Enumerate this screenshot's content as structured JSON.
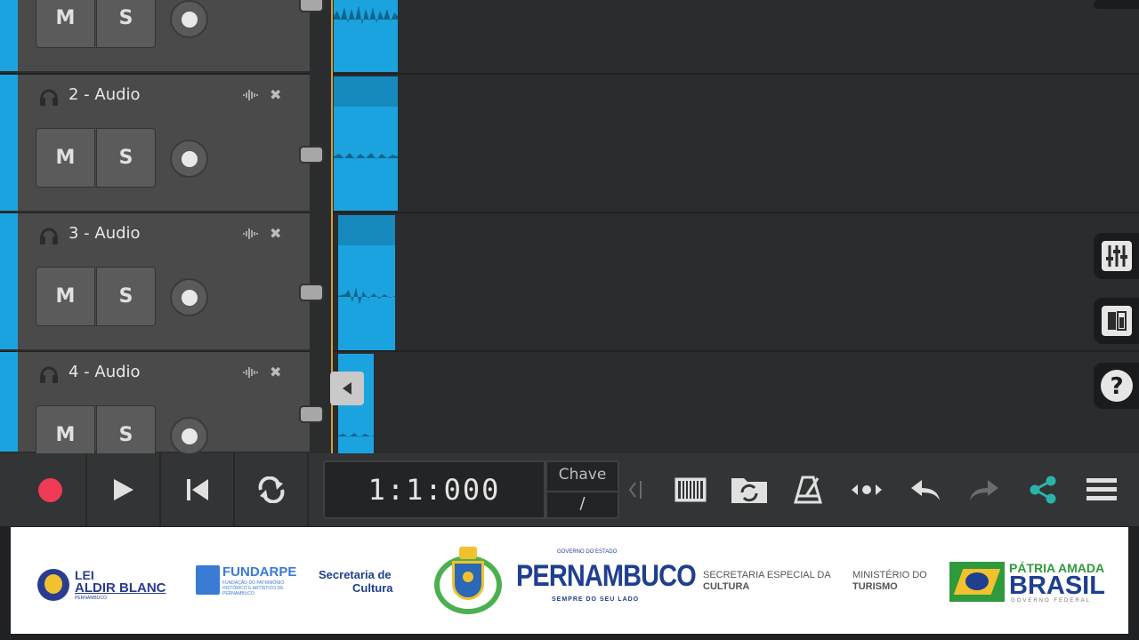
{
  "tracks": [
    {
      "name": "",
      "mute_label": "M",
      "solo_label": "S"
    },
    {
      "name": "2 - Audio",
      "mute_label": "M",
      "solo_label": "S"
    },
    {
      "name": "3 - Audio",
      "mute_label": "M",
      "solo_label": "S"
    },
    {
      "name": "4 - Audio",
      "mute_label": "M",
      "solo_label": "S"
    }
  ],
  "transport": {
    "position": "1:1:000",
    "key_label": "Chave",
    "key_value": "/"
  },
  "icons": {
    "record": "record-icon",
    "play": "play-icon",
    "rewind": "skip-to-start-icon",
    "loop": "loop-icon",
    "piano": "piano-keyboard-icon",
    "sync": "sync-folder-icon",
    "metronome": "metronome-icon",
    "nudge": "nudge-icon",
    "undo": "undo-icon",
    "redo": "redo-icon",
    "share": "share-icon",
    "menu": "hamburger-menu-icon",
    "mixer": "mixer-sliders-icon",
    "panel": "panel-icon",
    "help": "help-icon"
  },
  "colors": {
    "accent": "#1ba3e0",
    "record": "#ef3b55",
    "share": "#2bb3a8",
    "playhead": "#d1a03a"
  },
  "banner": {
    "lei": "LEI",
    "aldir_blanc": "ALDIR BLANC",
    "pernambuco_small": "PERNAMBUCO",
    "fundarpe": "FUNDARPE",
    "fundarpe_sub": "FUNDAÇÃO DO PATRIMÔNIO HISTÓRICO E ARTÍSTICO DE PERNAMBUCO",
    "secretaria": "Secretaria de",
    "cultura": "Cultura",
    "governo_estado": "GOVERNO DO ESTADO",
    "pernambuco": "PERNAMBUCO",
    "sempre": "SEMPRE DO SEU LADO",
    "sec_especial": "SECRETARIA ESPECIAL DA",
    "sec_cultura": "CULTURA",
    "ministerio": "MINISTÉRIO DO",
    "turismo": "TURISMO",
    "patria_amada": "PÁTRIA AMADA",
    "brasil": "BRASIL",
    "governo_federal": "GOVERNO FEDERAL"
  }
}
